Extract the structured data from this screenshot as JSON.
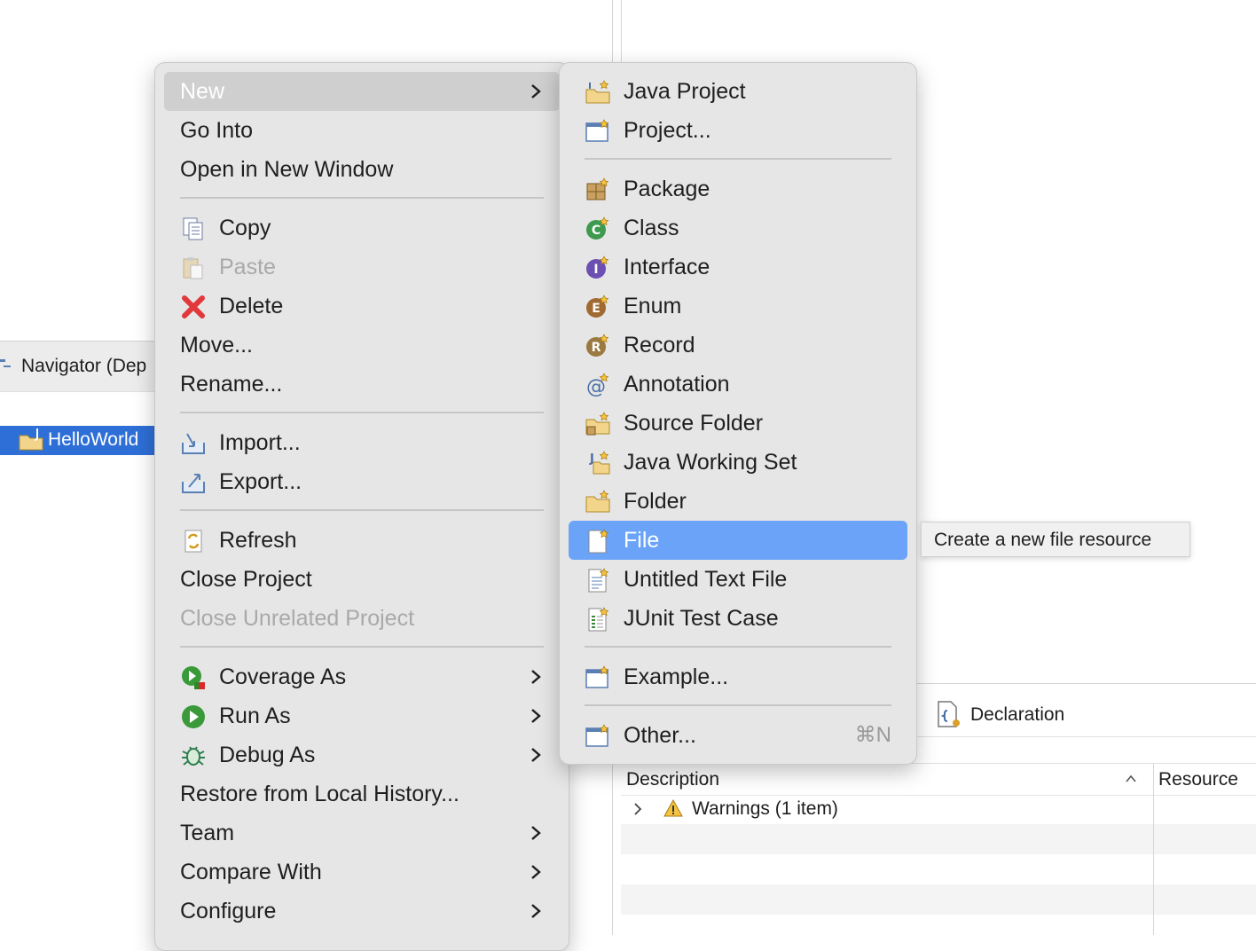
{
  "navigator": {
    "tab_label": "Navigator (Dep",
    "project_label": "HelloWorld"
  },
  "context_menu": {
    "items": {
      "new": "New",
      "go_into": "Go Into",
      "open_new_window": "Open in New Window",
      "copy": "Copy",
      "paste": "Paste",
      "delete": "Delete",
      "move": "Move...",
      "rename": "Rename...",
      "import": "Import...",
      "export": "Export...",
      "refresh": "Refresh",
      "close_project": "Close Project",
      "close_unrelated": "Close Unrelated Project",
      "coverage_as": "Coverage As",
      "run_as": "Run As",
      "debug_as": "Debug As",
      "restore": "Restore from Local History...",
      "team": "Team",
      "compare_with": "Compare With",
      "configure": "Configure"
    }
  },
  "new_submenu": {
    "items": {
      "java_project": "Java Project",
      "project": "Project...",
      "package": "Package",
      "class": "Class",
      "interface": "Interface",
      "enum": "Enum",
      "record": "Record",
      "annotation": "Annotation",
      "source_folder": "Source Folder",
      "java_working_set": "Java Working Set",
      "folder": "Folder",
      "file": "File",
      "untitled_text_file": "Untitled Text File",
      "junit_test_case": "JUnit Test Case",
      "example": "Example...",
      "other": "Other...",
      "other_shortcut": "⌘N"
    }
  },
  "tooltip": "Create a new file resource",
  "bottom_panel": {
    "declaration_tab": "Declaration",
    "col_description": "Description",
    "col_resource": "Resource",
    "warnings_row": "Warnings (1 item)"
  }
}
